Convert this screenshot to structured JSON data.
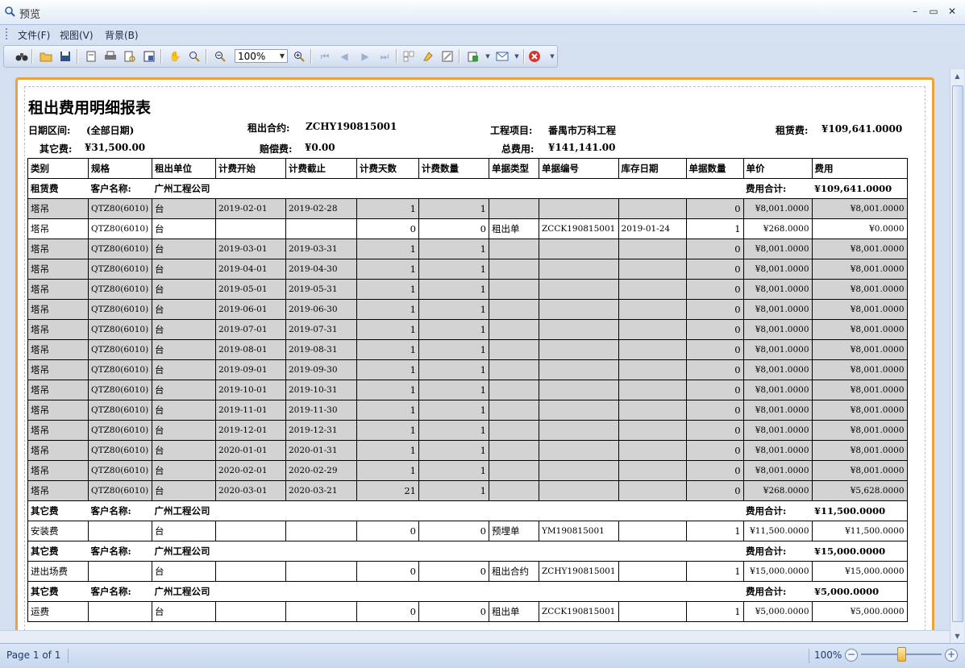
{
  "window": {
    "title": "预览"
  },
  "menu": {
    "items": [
      "文件(F)",
      "视图(V)",
      "背景(B)"
    ]
  },
  "toolbar": {
    "zoom_value": "100%",
    "icons": [
      "binoculars-icon",
      "open-icon",
      "save-icon",
      "page-setup-icon",
      "print-icon",
      "print-preview-icon",
      "scale-icon",
      "hand-icon",
      "magnifier-icon",
      "zoom-out-icon",
      "zoom-in-icon",
      "first-page-icon",
      "prev-page-icon",
      "next-page-icon",
      "last-page-icon",
      "multipage-icon",
      "color-icon",
      "watermark-icon",
      "export-icon",
      "email-icon",
      "close-preview-icon"
    ]
  },
  "report": {
    "title": "租出费用明细报表",
    "header": {
      "date_range_label": "日期区间:",
      "date_range_value": "(全部日期)",
      "contract_label": "租出合约:",
      "contract_value": "ZCHY190815001",
      "project_label": "工程项目:",
      "project_value": "番禺市万科工程",
      "rent_fee_label": "租赁费:",
      "rent_fee_value": "¥109,641.0000",
      "other_fee_label": "其它费:",
      "other_fee_value": "¥31,500.00",
      "compensation_label": "赔偿费:",
      "compensation_value": "¥0.00",
      "total_fee_label": "总费用:",
      "total_fee_value": "¥141,141.00"
    },
    "columns": [
      "类别",
      "规格",
      "租出单位",
      "计费开始",
      "计费截止",
      "计费天数",
      "计费数量",
      "单据类型",
      "单据编号",
      "库存日期",
      "单据数量",
      "单价",
      "费用"
    ],
    "groups": [
      {
        "category": "租赁费",
        "customer_label": "客户名称:",
        "customer": "广州工程公司",
        "total_label": "费用合计:",
        "total": "¥109,641.0000",
        "rows": [
          {
            "cat": "塔吊",
            "spec": "QTZ80(6010)",
            "unit": "台",
            "start": "2019-02-01",
            "end": "2019-02-28",
            "days": "1",
            "qty": "1",
            "doc_type": "",
            "doc_no": "",
            "stock_date": "",
            "doc_qty": "0",
            "price": "¥8,001.0000",
            "fee": "¥8,001.0000",
            "gray": true
          },
          {
            "cat": "塔吊",
            "spec": "QTZ80(6010)",
            "unit": "台",
            "start": "",
            "end": "",
            "days": "0",
            "qty": "0",
            "doc_type": "租出单",
            "doc_no": "ZCCK190815001",
            "stock_date": "2019-01-24",
            "doc_qty": "1",
            "price": "¥268.0000",
            "fee": "¥0.0000",
            "gray": false
          },
          {
            "cat": "塔吊",
            "spec": "QTZ80(6010)",
            "unit": "台",
            "start": "2019-03-01",
            "end": "2019-03-31",
            "days": "1",
            "qty": "1",
            "doc_type": "",
            "doc_no": "",
            "stock_date": "",
            "doc_qty": "0",
            "price": "¥8,001.0000",
            "fee": "¥8,001.0000",
            "gray": true
          },
          {
            "cat": "塔吊",
            "spec": "QTZ80(6010)",
            "unit": "台",
            "start": "2019-04-01",
            "end": "2019-04-30",
            "days": "1",
            "qty": "1",
            "doc_type": "",
            "doc_no": "",
            "stock_date": "",
            "doc_qty": "0",
            "price": "¥8,001.0000",
            "fee": "¥8,001.0000",
            "gray": true
          },
          {
            "cat": "塔吊",
            "spec": "QTZ80(6010)",
            "unit": "台",
            "start": "2019-05-01",
            "end": "2019-05-31",
            "days": "1",
            "qty": "1",
            "doc_type": "",
            "doc_no": "",
            "stock_date": "",
            "doc_qty": "0",
            "price": "¥8,001.0000",
            "fee": "¥8,001.0000",
            "gray": true
          },
          {
            "cat": "塔吊",
            "spec": "QTZ80(6010)",
            "unit": "台",
            "start": "2019-06-01",
            "end": "2019-06-30",
            "days": "1",
            "qty": "1",
            "doc_type": "",
            "doc_no": "",
            "stock_date": "",
            "doc_qty": "0",
            "price": "¥8,001.0000",
            "fee": "¥8,001.0000",
            "gray": true
          },
          {
            "cat": "塔吊",
            "spec": "QTZ80(6010)",
            "unit": "台",
            "start": "2019-07-01",
            "end": "2019-07-31",
            "days": "1",
            "qty": "1",
            "doc_type": "",
            "doc_no": "",
            "stock_date": "",
            "doc_qty": "0",
            "price": "¥8,001.0000",
            "fee": "¥8,001.0000",
            "gray": true
          },
          {
            "cat": "塔吊",
            "spec": "QTZ80(6010)",
            "unit": "台",
            "start": "2019-08-01",
            "end": "2019-08-31",
            "days": "1",
            "qty": "1",
            "doc_type": "",
            "doc_no": "",
            "stock_date": "",
            "doc_qty": "0",
            "price": "¥8,001.0000",
            "fee": "¥8,001.0000",
            "gray": true
          },
          {
            "cat": "塔吊",
            "spec": "QTZ80(6010)",
            "unit": "台",
            "start": "2019-09-01",
            "end": "2019-09-30",
            "days": "1",
            "qty": "1",
            "doc_type": "",
            "doc_no": "",
            "stock_date": "",
            "doc_qty": "0",
            "price": "¥8,001.0000",
            "fee": "¥8,001.0000",
            "gray": true
          },
          {
            "cat": "塔吊",
            "spec": "QTZ80(6010)",
            "unit": "台",
            "start": "2019-10-01",
            "end": "2019-10-31",
            "days": "1",
            "qty": "1",
            "doc_type": "",
            "doc_no": "",
            "stock_date": "",
            "doc_qty": "0",
            "price": "¥8,001.0000",
            "fee": "¥8,001.0000",
            "gray": true
          },
          {
            "cat": "塔吊",
            "spec": "QTZ80(6010)",
            "unit": "台",
            "start": "2019-11-01",
            "end": "2019-11-30",
            "days": "1",
            "qty": "1",
            "doc_type": "",
            "doc_no": "",
            "stock_date": "",
            "doc_qty": "0",
            "price": "¥8,001.0000",
            "fee": "¥8,001.0000",
            "gray": true
          },
          {
            "cat": "塔吊",
            "spec": "QTZ80(6010)",
            "unit": "台",
            "start": "2019-12-01",
            "end": "2019-12-31",
            "days": "1",
            "qty": "1",
            "doc_type": "",
            "doc_no": "",
            "stock_date": "",
            "doc_qty": "0",
            "price": "¥8,001.0000",
            "fee": "¥8,001.0000",
            "gray": true
          },
          {
            "cat": "塔吊",
            "spec": "QTZ80(6010)",
            "unit": "台",
            "start": "2020-01-01",
            "end": "2020-01-31",
            "days": "1",
            "qty": "1",
            "doc_type": "",
            "doc_no": "",
            "stock_date": "",
            "doc_qty": "0",
            "price": "¥8,001.0000",
            "fee": "¥8,001.0000",
            "gray": true
          },
          {
            "cat": "塔吊",
            "spec": "QTZ80(6010)",
            "unit": "台",
            "start": "2020-02-01",
            "end": "2020-02-29",
            "days": "1",
            "qty": "1",
            "doc_type": "",
            "doc_no": "",
            "stock_date": "",
            "doc_qty": "0",
            "price": "¥8,001.0000",
            "fee": "¥8,001.0000",
            "gray": true
          },
          {
            "cat": "塔吊",
            "spec": "QTZ80(6010)",
            "unit": "台",
            "start": "2020-03-01",
            "end": "2020-03-21",
            "days": "21",
            "qty": "1",
            "doc_type": "",
            "doc_no": "",
            "stock_date": "",
            "doc_qty": "0",
            "price": "¥268.0000",
            "fee": "¥5,628.0000",
            "gray": true
          }
        ]
      },
      {
        "category": "其它费",
        "customer_label": "客户名称:",
        "customer": "广州工程公司",
        "total_label": "费用合计:",
        "total": "¥11,500.0000",
        "rows": [
          {
            "cat": "安装费",
            "spec": "",
            "unit": "台",
            "start": "",
            "end": "",
            "days": "0",
            "qty": "0",
            "doc_type": "预埋单",
            "doc_no": "YM190815001",
            "stock_date": "",
            "doc_qty": "1",
            "price": "¥11,500.0000",
            "fee": "¥11,500.0000",
            "gray": false
          }
        ]
      },
      {
        "category": "其它费",
        "customer_label": "客户名称:",
        "customer": "广州工程公司",
        "total_label": "费用合计:",
        "total": "¥15,000.0000",
        "rows": [
          {
            "cat": "进出场费",
            "spec": "",
            "unit": "台",
            "start": "",
            "end": "",
            "days": "0",
            "qty": "0",
            "doc_type": "租出合约",
            "doc_no": "ZCHY190815001",
            "stock_date": "",
            "doc_qty": "1",
            "price": "¥15,000.0000",
            "fee": "¥15,000.0000",
            "gray": false
          }
        ]
      },
      {
        "category": "其它费",
        "customer_label": "客户名称:",
        "customer": "广州工程公司",
        "total_label": "费用合计:",
        "total": "¥5,000.0000",
        "rows": [
          {
            "cat": "运费",
            "spec": "",
            "unit": "台",
            "start": "",
            "end": "",
            "days": "0",
            "qty": "0",
            "doc_type": "租出单",
            "doc_no": "ZCCK190815001",
            "stock_date": "",
            "doc_qty": "1",
            "price": "¥5,000.0000",
            "fee": "¥5,000.0000",
            "gray": false
          }
        ]
      }
    ]
  },
  "status": {
    "page_text": "Page 1 of 1",
    "zoom_text": "100%",
    "zoom_fraction": 0.5
  }
}
